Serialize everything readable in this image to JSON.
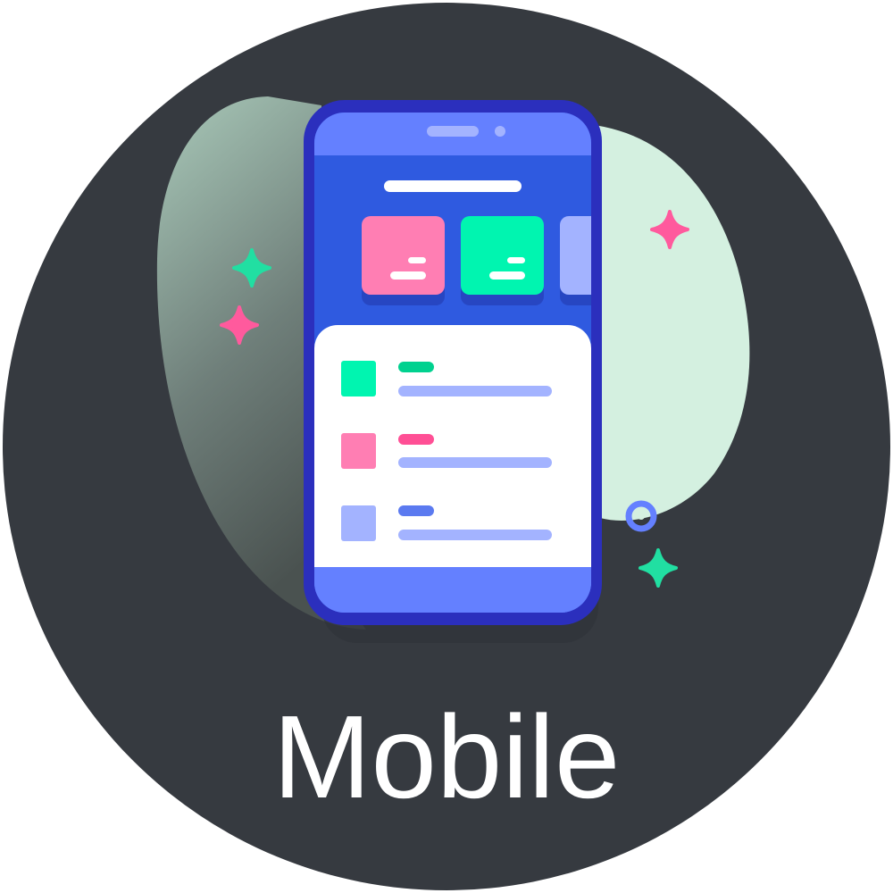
{
  "badge": {
    "label": "Mobile",
    "background_color": "#363a40",
    "text_color": "#ffffff"
  },
  "illustration": {
    "subject": "smartphone-app-icon",
    "phone_frame_color": "#2b2fbd",
    "phone_header_color": "#2f5ae0",
    "phone_topbar_color": "#6480ff",
    "accent_colors": [
      "#ff7eb3",
      "#00f5b0",
      "#a3b3ff"
    ],
    "blob_colors": [
      "#a8c6b8",
      "#d4f0e0"
    ],
    "icons": [
      "sparkle-icon",
      "sparkle-icon",
      "sparkle-icon",
      "sparkle-icon",
      "ring-icon"
    ]
  }
}
